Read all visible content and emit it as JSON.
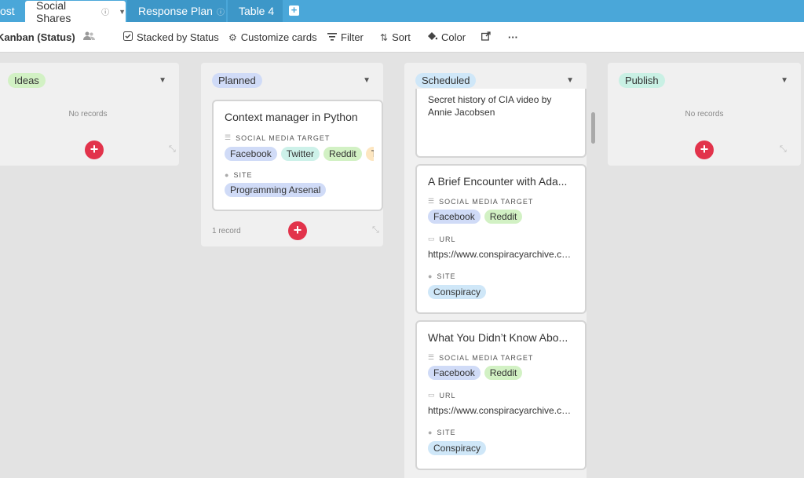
{
  "tabs": [
    {
      "label": "ost"
    },
    {
      "label": "Social Shares",
      "info": "ⓘ",
      "caret": "▼"
    },
    {
      "label": "Response Plan",
      "info": "ⓘ"
    },
    {
      "label": "Table 4"
    }
  ],
  "add_tab": "+",
  "toolbar": {
    "view_name": "Kanban (Status)",
    "stacked": "Stacked by Status",
    "customize": "Customize cards",
    "filter": "Filter",
    "sort": "Sort",
    "color": "Color",
    "more": "···"
  },
  "icons": {
    "collaborators": "people-icon",
    "stacked": "checkbox-icon",
    "customize": "gear-icon",
    "filter": "filter-icon",
    "sort": "sort-icon",
    "color": "paint-bucket-icon",
    "share": "share-icon"
  },
  "colors": {
    "tabbar": "#4aa7d9",
    "ideas": "#d2f1c4",
    "planned": "#d0dbf7",
    "scheduled": "#cfe7f8",
    "publish": "#c9f0e4",
    "facebook": "#d0dbf7",
    "twitter": "#cdf1e9",
    "reddit": "#d2f1c4",
    "other": "#fde6c0",
    "site_programming": "#d0dbf7",
    "site_conspiracy": "#cfe7f8",
    "add": "#e2334b"
  },
  "columns": {
    "ideas": {
      "label": "Ideas",
      "empty": "No records"
    },
    "planned": {
      "label": "Planned",
      "count": "1 record"
    },
    "scheduled": {
      "label": "Scheduled"
    },
    "publish": {
      "label": "Publish",
      "empty": "No records"
    }
  },
  "labels": {
    "social_media_target": "SOCIAL MEDIA TARGET",
    "url": "URL",
    "site": "SITE"
  },
  "cards": {
    "planned_1": {
      "title": "Context manager in Python",
      "tags": [
        "Facebook",
        "Twitter",
        "Reddit",
        "T"
      ],
      "site": "Programming Arsenal"
    },
    "scheduled_0": {
      "text": "Secret history of CIA video by Annie Jacobsen"
    },
    "scheduled_1": {
      "title": "A Brief Encounter with Ada...",
      "tags": [
        "Facebook",
        "Reddit"
      ],
      "url": "https://www.conspiracyarchive.co...",
      "site": "Conspiracy"
    },
    "scheduled_2": {
      "title": "What You Didn’t Know Abo...",
      "tags": [
        "Facebook",
        "Reddit"
      ],
      "url": "https://www.conspiracyarchive.co...",
      "site": "Conspiracy"
    }
  },
  "add_symbol": "+"
}
